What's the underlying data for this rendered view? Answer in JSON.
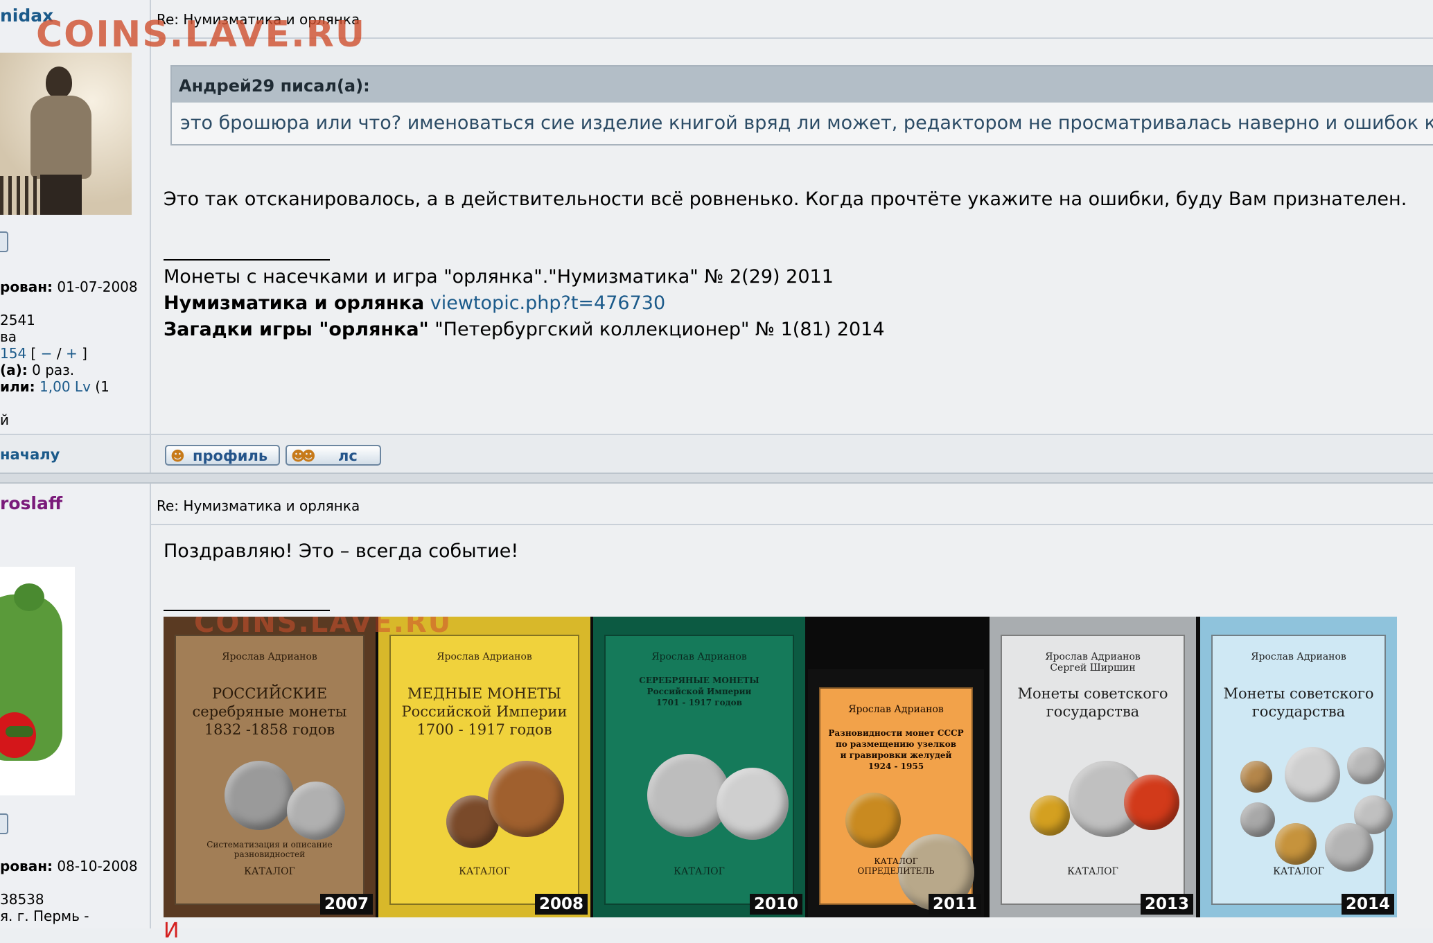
{
  "watermark": "COINS.LAVE.RU",
  "post1": {
    "author": "nidax",
    "subject": "Re: Нумизматика и орлянка",
    "profile": {
      "registered_label": "рован:",
      "registered_value": "01-07-2008",
      "posts": "2541",
      "location": "ва",
      "reputation_num": "154",
      "reputation_open": "[",
      "rep_minus": "−",
      "rep_slash": "/",
      "rep_plus": "+",
      "reputation_close": "]",
      "thanked_label": "(а):",
      "thanked_value": "0 раз.",
      "rated_label": "или:",
      "rated_value": "1,00 Lv",
      "rated_suffix": "(1",
      "extra": "й"
    },
    "quote": {
      "author": "Андрей29 писал(а):",
      "text": "это брошюра или что? именоваться сие изделие книгой вряд ли может, редактором не просматривалась наверно и ошибок куча"
    },
    "body": "Это так отсканировалось, а в действительности всё ровненько. Когда прочтёте укажите на ошибки, буду Вам признателен.",
    "signature": {
      "line1": "Монеты с насечками и игра \"орлянка\".\"Нумизматика\" № 2(29) 2011",
      "line2_bold": "Нумизматика и орлянка",
      "line2_link": "viewtopic.php?t=476730",
      "line3_bold": "Загадки игры \"орлянка\"",
      "line3_text": "\"Петербургский коллекционер\" № 1(81) 2014"
    },
    "back_to_top": "началу",
    "buttons": {
      "profile": "профиль",
      "pm": "лс"
    }
  },
  "post2": {
    "author": "roslaff",
    "subject": "Re: Нумизматика и орлянка",
    "profile": {
      "registered_label": "рован:",
      "registered_value": "08-10-2008",
      "posts": "38538",
      "location": "я. г. Пермь -"
    },
    "body": "Поздравляю! Это – всегда событие!",
    "red_text": "И"
  },
  "books": [
    {
      "author": "Ярослав Адрианов",
      "title": "РОССИЙСКИЕ\nсеребряные монеты\n1832 -1858 годов",
      "bottom": "Систематизация и описание\nразновидностей",
      "katalog": "КАТАЛОГ",
      "year": "2007",
      "bg": "#5a3a22",
      "cover": "#a27e56",
      "ink": "#2a1a0a"
    },
    {
      "author": "Ярослав Адрианов",
      "title": "МЕДНЫЕ МОНЕТЫ\nРоссийской Империи\n1700 - 1917 годов",
      "bottom": "",
      "katalog": "КАТАЛОГ",
      "year": "2008",
      "bg": "#d8b82a",
      "cover": "#f0d23c",
      "ink": "#3a2a10"
    },
    {
      "author": "Ярослав Адрианов",
      "title": "СЕРЕБРЯНЫЕ МОНЕТЫ\nРоссийской Империи\n1701 - 1917 годов",
      "bottom": "",
      "katalog": "КАТАЛОГ",
      "year": "2010",
      "bg": "#0c5a42",
      "cover": "#157a5a",
      "ink": "#0a2a20"
    },
    {
      "author": "Ярослав Адрианов",
      "title": "Разновидности монет СССР\nпо размещению узелков\nи гравировки желудей\n1924 - 1955",
      "bottom": "КАТАЛОГ\nОПРЕДЕЛИТЕЛЬ",
      "katalog": "",
      "year": "2011",
      "bg": "#111111",
      "cover": "#f2a24a",
      "ink": "#1a0a00"
    },
    {
      "author": "Ярослав Адрианов\nСергей Ширшин",
      "title": "Монеты советского\nгосударства",
      "bottom": "",
      "katalog": "КАТАЛОГ",
      "year": "2013",
      "bg": "#a9adb0",
      "cover": "#e4e5e6",
      "ink": "#1e1e1e"
    },
    {
      "author": "Ярослав Адрианов",
      "title": "Монеты советского\nгосударства",
      "bottom": "",
      "katalog": "КАТАЛОГ",
      "year": "2014",
      "bg": "#8fc3dc",
      "cover": "#cfe8f4",
      "ink": "#1e1e1e"
    }
  ]
}
